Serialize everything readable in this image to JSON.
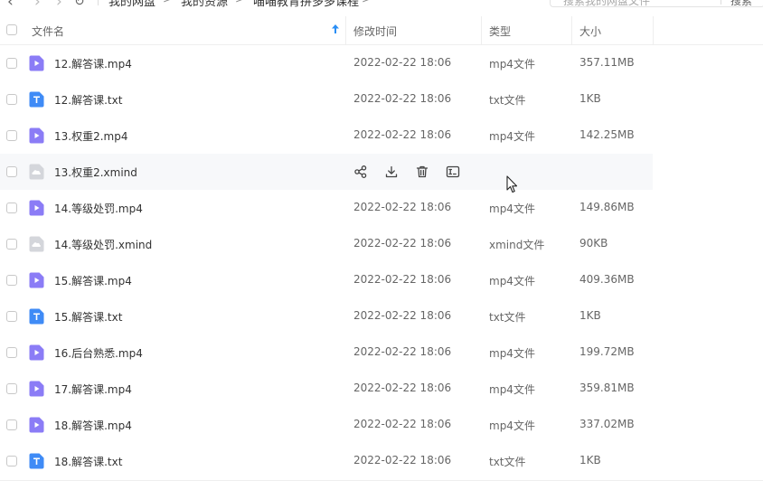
{
  "breadcrumb": {
    "items": [
      "我的网盘",
      "我的资源",
      "喵喵教育拼多多课程"
    ],
    "separator": ">"
  },
  "search": {
    "placeholder": "搜索我的网盘文件",
    "button_label": "搜索"
  },
  "columns": {
    "name": "文件名",
    "modified": "修改时间",
    "type": "类型",
    "size": "大小"
  },
  "files": [
    {
      "name": "12.解答课.mp4",
      "date": "2022-02-22 18:06",
      "type": "mp4文件",
      "size": "357.11MB",
      "icon": "video-file-icon"
    },
    {
      "name": "12.解答课.txt",
      "date": "2022-02-22 18:06",
      "type": "txt文件",
      "size": "1KB",
      "icon": "text-file-icon"
    },
    {
      "name": "13.权重2.mp4",
      "date": "2022-02-22 18:06",
      "type": "mp4文件",
      "size": "142.25MB",
      "icon": "video-file-icon"
    },
    {
      "name": "13.权重2.xmind",
      "date": "",
      "type": "",
      "size": "",
      "icon": "xmind-file-icon",
      "hover": true
    },
    {
      "name": "14.等级处罚.mp4",
      "date": "2022-02-22 18:06",
      "type": "mp4文件",
      "size": "149.86MB",
      "icon": "video-file-icon"
    },
    {
      "name": "14.等级处罚.xmind",
      "date": "2022-02-22 18:06",
      "type": "xmind文件",
      "size": "90KB",
      "icon": "xmind-file-icon"
    },
    {
      "name": "15.解答课.mp4",
      "date": "2022-02-22 18:06",
      "type": "mp4文件",
      "size": "409.36MB",
      "icon": "video-file-icon"
    },
    {
      "name": "15.解答课.txt",
      "date": "2022-02-22 18:06",
      "type": "txt文件",
      "size": "1KB",
      "icon": "text-file-icon"
    },
    {
      "name": "16.后台熟悉.mp4",
      "date": "2022-02-22 18:06",
      "type": "mp4文件",
      "size": "199.72MB",
      "icon": "video-file-icon"
    },
    {
      "name": "17.解答课.mp4",
      "date": "2022-02-22 18:06",
      "type": "mp4文件",
      "size": "359.81MB",
      "icon": "video-file-icon"
    },
    {
      "name": "18.解答课.mp4",
      "date": "2022-02-22 18:06",
      "type": "mp4文件",
      "size": "337.02MB",
      "icon": "video-file-icon"
    },
    {
      "name": "18.解答课.txt",
      "date": "2022-02-22 18:06",
      "type": "txt文件",
      "size": "1KB",
      "icon": "text-file-icon"
    }
  ],
  "row_actions": [
    "share-icon",
    "download-icon",
    "delete-icon",
    "rename-icon"
  ],
  "colors": {
    "video_icon": "#8b7cf6",
    "text_icon": "#3f8bf6",
    "xmind_icon": "#d4d6db",
    "sort_accent": "#2a8ef5",
    "hover_row": "#f7f8fa"
  }
}
